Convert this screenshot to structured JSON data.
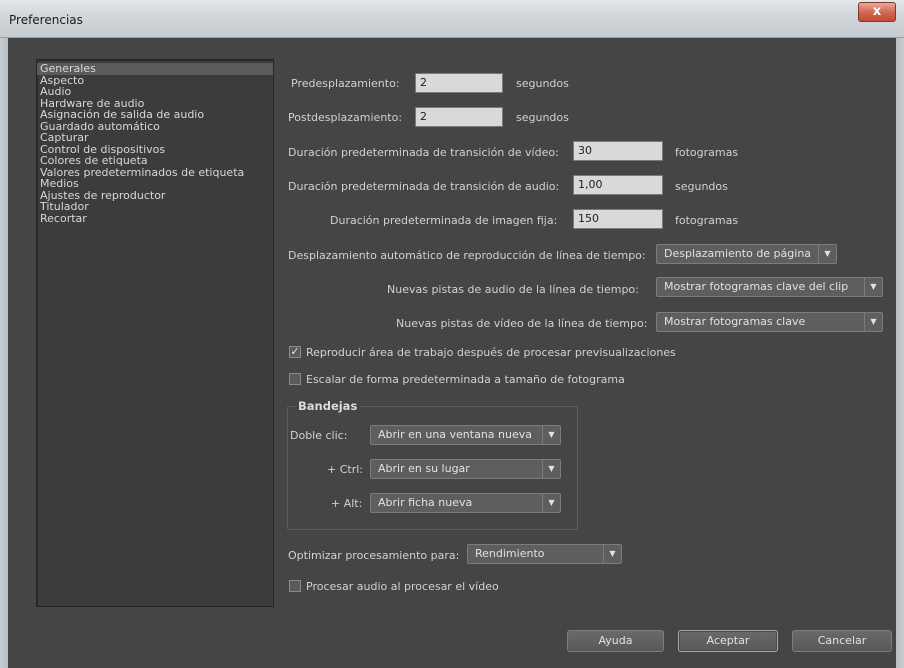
{
  "window": {
    "title": "Preferencias",
    "close_label": "x"
  },
  "sidebar": {
    "items": [
      {
        "label": "Generales",
        "selected": true
      },
      {
        "label": "Aspecto"
      },
      {
        "label": "Audio"
      },
      {
        "label": "Hardware de audio"
      },
      {
        "label": "Asignación de salida de audio"
      },
      {
        "label": "Guardado automático"
      },
      {
        "label": "Capturar"
      },
      {
        "label": "Control de dispositivos"
      },
      {
        "label": "Colores de etiqueta"
      },
      {
        "label": "Valores predeterminados de etiqueta"
      },
      {
        "label": "Medios"
      },
      {
        "label": "Ajustes de reproductor"
      },
      {
        "label": "Titulador"
      },
      {
        "label": "Recortar"
      }
    ]
  },
  "general": {
    "preroll": {
      "label": "Predesplazamiento:",
      "value": "2",
      "unit": "segundos"
    },
    "postroll": {
      "label": "Postdesplazamiento:",
      "value": "2",
      "unit": "segundos"
    },
    "video_transition": {
      "label": "Duración predeterminada de transición de vídeo:",
      "value": "30",
      "unit": "fotogramas"
    },
    "audio_transition": {
      "label": "Duración predeterminada de transición de audio:",
      "value": "1,00",
      "unit": "segundos"
    },
    "still_duration": {
      "label": "Duración predeterminada de imagen fija:",
      "value": "150",
      "unit": "fotogramas"
    },
    "autoscroll": {
      "label": "Desplazamiento automático de reproducción de línea de tiempo:",
      "value": "Desplazamiento de página"
    },
    "new_audio_tracks": {
      "label": "Nuevas pistas de audio de la línea de tiempo:",
      "value": "Mostrar fotogramas clave del clip"
    },
    "new_video_tracks": {
      "label": "Nuevas pistas de vídeo de la línea de tiempo:",
      "value": "Mostrar fotogramas clave"
    },
    "play_work_area": {
      "label": "Reproducir área de trabajo después de procesar previsualizaciones",
      "checked": true
    },
    "scale_to_frame": {
      "label": "Escalar de forma predeterminada a tamaño de fotograma",
      "checked": false
    },
    "bins": {
      "title": "Bandejas",
      "double_click": {
        "label": "Doble clic:",
        "value": "Abrir en una ventana nueva"
      },
      "ctrl": {
        "label": "+ Ctrl:",
        "value": "Abrir en su lugar"
      },
      "alt": {
        "label": "+ Alt:",
        "value": "Abrir ficha nueva"
      }
    },
    "optimize": {
      "label": "Optimizar procesamiento para:",
      "value": "Rendimiento"
    },
    "render_audio": {
      "label": "Procesar audio al procesar el vídeo",
      "checked": false
    }
  },
  "buttons": {
    "help": "Ayuda",
    "ok": "Aceptar",
    "cancel": "Cancelar"
  },
  "icons": {
    "dropdown": "chevron-down-icon",
    "checkmark": "checkmark-icon"
  }
}
